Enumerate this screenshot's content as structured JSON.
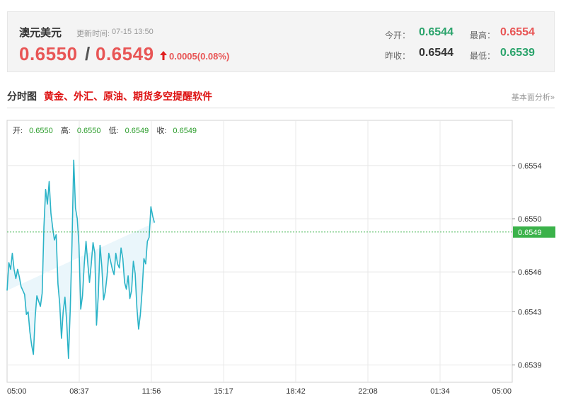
{
  "quote": {
    "name": "澳元美元",
    "update_label": "更新时间:",
    "update_time": "07-15 13:50",
    "bid": "0.6550",
    "separator": "/",
    "ask": "0.6549",
    "change": "0.0005(0.08%)",
    "direction": "up",
    "stats": [
      {
        "label": "今开：",
        "value": "0.6544",
        "color": "#2aa36b"
      },
      {
        "label": "最高：",
        "value": "0.6554",
        "color": "#e85555"
      },
      {
        "label": "昨收：",
        "value": "0.6544",
        "color": "#333333"
      },
      {
        "label": "最低：",
        "value": "0.6539",
        "color": "#2aa36b"
      }
    ]
  },
  "section": {
    "title": "分时图",
    "ad_text": "黄金、外汇、原油、期货多空提醒软件",
    "side_link": "基本面分析»"
  },
  "ohlc": {
    "open_label": "开:",
    "open": "0.6550",
    "high_label": "高:",
    "high": "0.6550",
    "low_label": "低:",
    "low": "0.6549",
    "close_label": "收:",
    "close": "0.6549"
  },
  "chart_data": {
    "type": "area",
    "x_ticks": [
      "05:00",
      "08:37",
      "11:56",
      "15:17",
      "18:42",
      "22:08",
      "01:34",
      "05:00"
    ],
    "y_ticks": [
      "0.6554",
      "0.6550",
      "0.6546",
      "0.6543",
      "0.6539"
    ],
    "y_tick_values": [
      0.6554,
      0.655,
      0.6546,
      0.6543,
      0.6539
    ],
    "ylim": [
      0.65377,
      0.65574
    ],
    "session_minutes": 1440,
    "current_price": "0.6549",
    "current_value": 0.6549,
    "colors": {
      "line": "#2bb3c7",
      "fill": "#eaf6fb",
      "current": "#3bb24a",
      "grid": "#e8e8e8"
    },
    "minutes": [
      0,
      5,
      10,
      15,
      20,
      25,
      30,
      35,
      40,
      45,
      50,
      55,
      60,
      65,
      70,
      75,
      80,
      85,
      90,
      95,
      100,
      105,
      110,
      115,
      120,
      125,
      130,
      135,
      140,
      145,
      150,
      155,
      160,
      165,
      170,
      175,
      180,
      185,
      190,
      195,
      200,
      205,
      210,
      215,
      220,
      225,
      230,
      235,
      240,
      245,
      250,
      255,
      260,
      265,
      270,
      275,
      280,
      285,
      290,
      295,
      300,
      305,
      310,
      315,
      320,
      325,
      330,
      335,
      340,
      345,
      350,
      355,
      360,
      365,
      370,
      375,
      380,
      385,
      390,
      395,
      400,
      405,
      410,
      415,
      420,
      425,
      430,
      435,
      440,
      445,
      450,
      455,
      460,
      465,
      470,
      475,
      480,
      485,
      490,
      495,
      500,
      505,
      510,
      515,
      520,
      525,
      530,
      535,
      540
    ],
    "values": [
      0.65446,
      0.65467,
      0.65462,
      0.65474,
      0.65462,
      0.65455,
      0.65462,
      0.65456,
      0.65449,
      0.65446,
      0.65443,
      0.65428,
      0.6543,
      0.65415,
      0.65405,
      0.65398,
      0.65426,
      0.65442,
      0.65438,
      0.65434,
      0.65444,
      0.65494,
      0.65522,
      0.65511,
      0.65528,
      0.65504,
      0.65493,
      0.65484,
      0.65488,
      0.65451,
      0.65436,
      0.6541,
      0.6543,
      0.65441,
      0.65422,
      0.65395,
      0.65432,
      0.6548,
      0.65544,
      0.65508,
      0.655,
      0.6548,
      0.65432,
      0.65442,
      0.65466,
      0.65483,
      0.65467,
      0.65452,
      0.65466,
      0.65482,
      0.65474,
      0.6542,
      0.65442,
      0.6548,
      0.65464,
      0.65439,
      0.65445,
      0.65457,
      0.65474,
      0.65468,
      0.65462,
      0.65458,
      0.65474,
      0.65466,
      0.65463,
      0.65478,
      0.6547,
      0.65452,
      0.65447,
      0.65457,
      0.6544,
      0.65446,
      0.65468,
      0.65459,
      0.65433,
      0.65417,
      0.65428,
      0.65446,
      0.6547,
      0.65466,
      0.65483,
      0.65486,
      0.65509,
      0.65502,
      0.65497
    ]
  }
}
